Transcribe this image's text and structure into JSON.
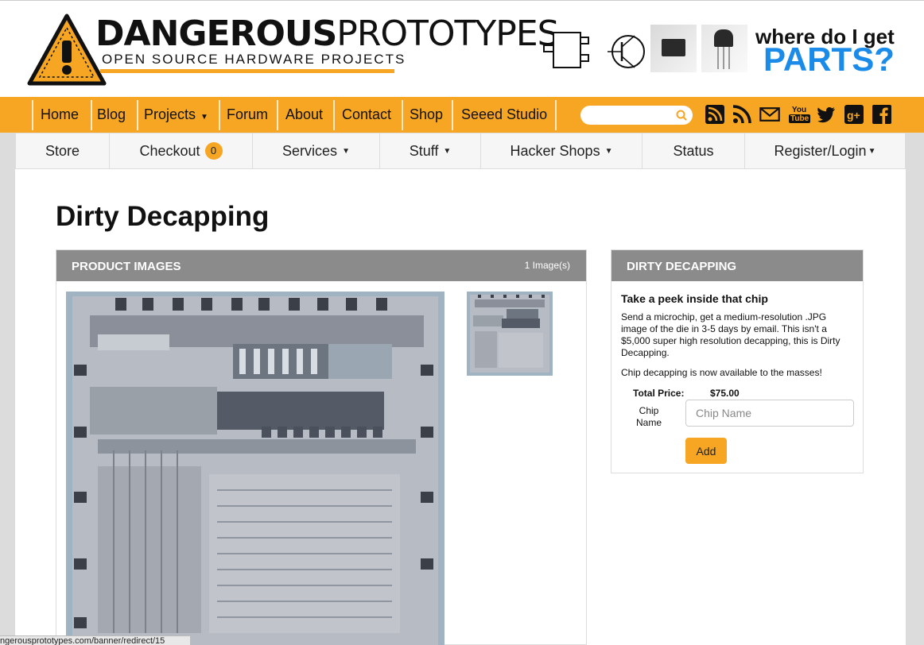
{
  "header": {
    "logo": {
      "title_bold": "DANGEROUS",
      "title_thin": "PROTOTYPES",
      "subtitle": "OPEN SOURCE HARDWARE PROJECTS"
    },
    "parts_banner": {
      "line1": "where do I get",
      "line2": "PARTS?"
    }
  },
  "main_nav": {
    "items": [
      {
        "label": "Home"
      },
      {
        "label": "Blog"
      },
      {
        "label": "Projects",
        "dropdown": true
      },
      {
        "label": "Forum"
      },
      {
        "label": "About"
      },
      {
        "label": "Contact"
      },
      {
        "label": "Shop"
      },
      {
        "label": "Seeed Studio"
      }
    ],
    "search_placeholder": "",
    "social_icons": [
      "rss-icon",
      "feed-icon",
      "mail-icon",
      "youtube-icon",
      "twitter-icon",
      "google-plus-icon",
      "facebook-icon"
    ]
  },
  "sub_nav": {
    "items": [
      {
        "label": "Store"
      },
      {
        "label": "Checkout",
        "badge": "0"
      },
      {
        "label": "Services",
        "dropdown": true
      },
      {
        "label": "Stuff",
        "dropdown": true
      },
      {
        "label": "Hacker Shops",
        "dropdown": true
      },
      {
        "label": "Status"
      },
      {
        "label": "Register/Login",
        "dropdown": true
      }
    ]
  },
  "page": {
    "title": "Dirty Decapping",
    "images_panel": {
      "title": "PRODUCT IMAGES",
      "count": "1 Image(s)"
    },
    "product_panel": {
      "title": "DIRTY DECAPPING",
      "heading": "Take a peek inside that chip",
      "description": "Send a microchip, get a medium-resolution .JPG image of the die in 3-5 days by email. This isn't a $5,000 super high resolution decapping, this is Dirty Decapping.",
      "note": "Chip decapping is now available to the masses!",
      "price_label": "Total Price:",
      "price_value": "$75.00",
      "chip_label": "Chip Name",
      "chip_placeholder": "Chip Name",
      "add_label": "Add"
    }
  },
  "status_bar": {
    "url": "ngerousprototypes.com/banner/redirect/15"
  },
  "colors": {
    "accent": "#f6a623",
    "panel_header": "#8b8b8b",
    "parts_blue": "#1a8be8"
  }
}
